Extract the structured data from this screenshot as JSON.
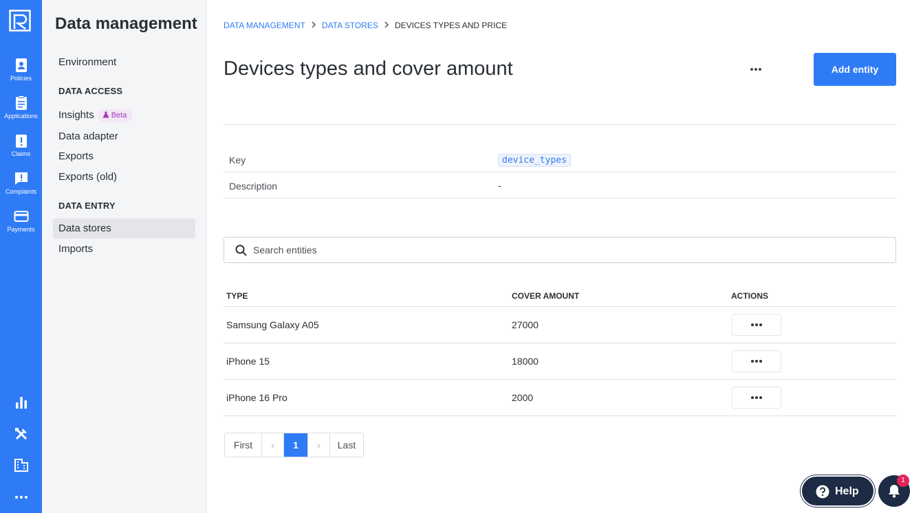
{
  "rail": {
    "items": [
      {
        "label": "Policies",
        "icon": "policies-icon"
      },
      {
        "label": "Applications",
        "icon": "applications-icon"
      },
      {
        "label": "Claims",
        "icon": "claims-icon"
      },
      {
        "label": "Complaints",
        "icon": "complaints-icon"
      },
      {
        "label": "Payments",
        "icon": "payments-icon"
      }
    ],
    "bottom_icons": [
      "bar-chart-icon",
      "tools-icon",
      "building-icon",
      "more-icon"
    ],
    "accent": "#2f7bf5"
  },
  "sidebar": {
    "title": "Data management",
    "environment": "Environment",
    "data_access_heading": "DATA ACCESS",
    "insights": "Insights",
    "beta_badge": "Beta",
    "data_adapter": "Data adapter",
    "exports": "Exports",
    "exports_old": "Exports (old)",
    "data_entry_heading": "DATA ENTRY",
    "data_stores": "Data stores",
    "imports": "Imports"
  },
  "breadcrumb": {
    "item1": "DATA MANAGEMENT",
    "item2": "DATA STORES",
    "current": "DEVICES TYPES AND PRICE"
  },
  "page": {
    "title": "Devices types and cover amount",
    "add_button": "Add entity"
  },
  "details": {
    "key_label": "Key",
    "key_value": "device_types",
    "description_label": "Description",
    "description_value": "-"
  },
  "search": {
    "placeholder": "Search entities"
  },
  "table": {
    "headers": {
      "type": "TYPE",
      "cover": "COVER AMOUNT",
      "actions": "ACTIONS"
    },
    "rows": [
      {
        "type": "Samsung Galaxy A05",
        "cover": "27000"
      },
      {
        "type": "iPhone 15",
        "cover": "18000"
      },
      {
        "type": "iPhone 16 Pro",
        "cover": "2000"
      }
    ]
  },
  "pagination": {
    "first": "First",
    "prev": "‹",
    "current": "1",
    "next": "›",
    "last": "Last"
  },
  "help": {
    "label": "Help",
    "notification_count": "1"
  }
}
